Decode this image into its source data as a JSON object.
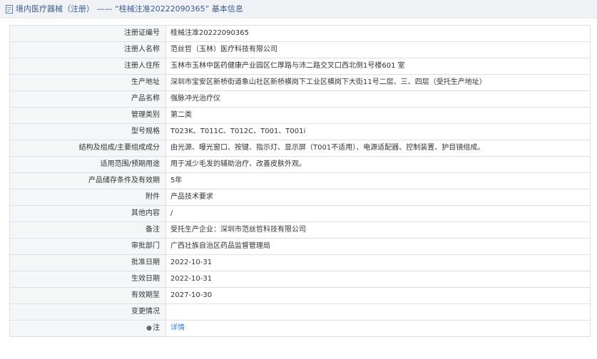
{
  "header": {
    "title": "境内医疗器械（注册） —— “桂械注准20222090365” 基本信息",
    "icon": "document-icon"
  },
  "rows": [
    {
      "label": "注册证编号",
      "value": "桂械注准20222090365"
    },
    {
      "label": "注册人名称",
      "value": "范丝哲（玉林）医疗科技有限公司"
    },
    {
      "label": "注册人住所",
      "value": "玉林市玉林中医药健康产业园区仁厚路与沛二路交叉口西北侧1号楼601 室"
    },
    {
      "label": "生产地址",
      "value": "深圳市宝安区新桥街道象山社区新桥横岗下工业区横岗下大街11号二层、三、四层（受托生产地址）"
    },
    {
      "label": "产品名称",
      "value": "强脉冲光治疗仪"
    },
    {
      "label": "管理类别",
      "value": "第二类"
    },
    {
      "label": "型号规格",
      "value": "T023K、T011C、T012C、T001、T001i"
    },
    {
      "label": "结构及组成/主要组成成分",
      "value": "由光源、曝光窗口、按键、指示灯、显示屏（T001不适用）、电源适配器、控制装置、护目镜组成。"
    },
    {
      "label": "适用范围/预期用途",
      "value": "用于减少毛发的辅助治疗、改善皮肤外观。"
    },
    {
      "label": "产品储存条件及有效期",
      "value": "5年"
    },
    {
      "label": "附件",
      "value": "产品技术要求"
    },
    {
      "label": "其他内容",
      "value": "/"
    },
    {
      "label": "备注",
      "value": "受托生产企业：深圳市范丝哲科技有限公司"
    },
    {
      "label": "审批部门",
      "value": "广西壮族自治区药品监督管理局"
    },
    {
      "label": "批准日期",
      "value": "2022-10-31"
    },
    {
      "label": "生效日期",
      "value": "2022-10-31"
    },
    {
      "label": "有效期至",
      "value": "2027-10-30"
    },
    {
      "label": "变更情况",
      "value": ""
    }
  ],
  "detail_row": {
    "label": "注",
    "icon": "bell-icon",
    "link_text": "详情"
  },
  "colors": {
    "link": "#3b7bd6",
    "header_text": "#3a5d8f",
    "label_bg": "#f5f6f8",
    "border": "#dcdfe3"
  }
}
